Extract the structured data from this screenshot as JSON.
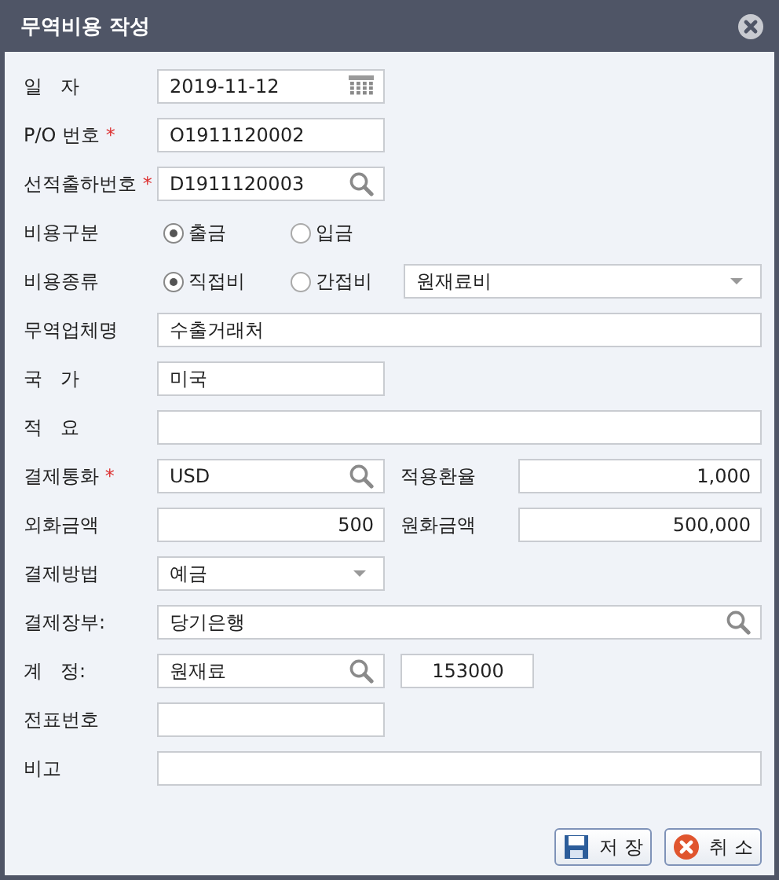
{
  "window": {
    "title": "무역비용 작성"
  },
  "rows": [
    {
      "label": "일   자",
      "items": [
        {
          "kind": "date",
          "value": "2019-11-12",
          "wide": false
        }
      ]
    },
    {
      "label": "P/O 번호",
      "mark": "*",
      "items": [
        {
          "kind": "text",
          "value": "O1911120002",
          "wide": false
        }
      ]
    },
    {
      "label": "선적출하번호",
      "mark": "*",
      "items": [
        {
          "kind": "lookup",
          "value": "D1911120003",
          "wide": false
        }
      ]
    },
    {
      "label": "비용구분",
      "items": [
        {
          "kind": "radio",
          "label": "출금",
          "selected": true
        },
        {
          "kind": "radio",
          "label": "입금",
          "selected": false
        }
      ]
    },
    {
      "label": "비용종류",
      "items": [
        {
          "kind": "radio",
          "label": "직접비",
          "selected": true
        },
        {
          "kind": "radio",
          "label": "간접비",
          "selected": false
        },
        {
          "kind": "select",
          "value": "원재료비",
          "wide": true
        }
      ]
    },
    {
      "label": "무역업체명",
      "items": [
        {
          "kind": "text",
          "value": "수출거래처",
          "wide": true
        }
      ]
    },
    {
      "label": "국   가",
      "items": [
        {
          "kind": "text",
          "value": "미국",
          "wide": false
        }
      ]
    },
    {
      "label": "적   요",
      "items": [
        {
          "kind": "text",
          "wide": true
        }
      ]
    },
    {
      "label": "결제통화",
      "mark": "*",
      "items": [
        {
          "kind": "lookup",
          "value": "USD",
          "wide": false
        },
        {
          "kind": "label",
          "text": "적용환율"
        },
        {
          "kind": "number",
          "value": "1,000",
          "wide": true
        }
      ]
    },
    {
      "label": "외화금액",
      "items": [
        {
          "kind": "number",
          "value": "500",
          "wide": false
        },
        {
          "kind": "label",
          "text": "원화금액"
        },
        {
          "kind": "number",
          "value": "500,000",
          "wide": true
        }
      ]
    },
    {
      "label": "결제방법",
      "items": [
        {
          "kind": "select",
          "value": "예금",
          "wide": false
        }
      ]
    },
    {
      "label": "결제장부:",
      "items": [
        {
          "kind": "lookup",
          "value": "당기은행",
          "wide": true
        }
      ]
    },
    {
      "label": "계   정:",
      "items": [
        {
          "kind": "lookup",
          "value": "원재료",
          "wide": false
        },
        {
          "kind": "code",
          "value": "153000"
        }
      ]
    },
    {
      "label": "전표번호",
      "items": [
        {
          "kind": "text",
          "wide": false
        }
      ]
    },
    {
      "label": "비고",
      "items": [
        {
          "kind": "text",
          "wide": true
        }
      ]
    }
  ],
  "buttons": [
    {
      "kind": "save",
      "label": "저 장"
    },
    {
      "kind": "cancel",
      "label": "취 소"
    }
  ]
}
